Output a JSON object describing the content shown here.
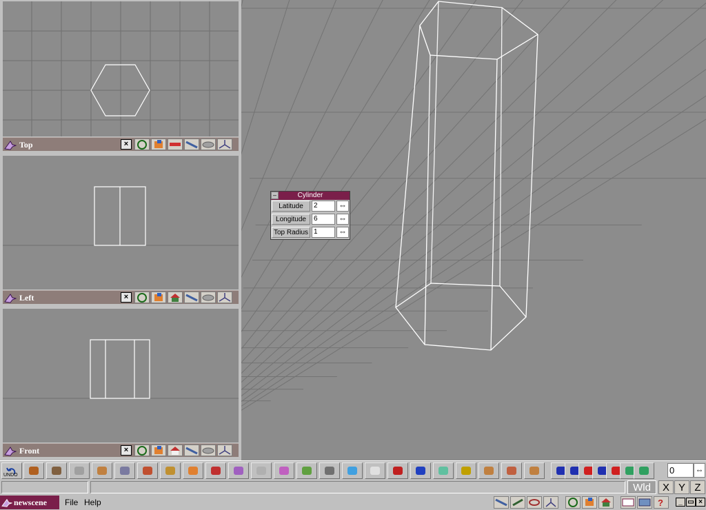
{
  "viewports": [
    {
      "title": "Top",
      "close": "×"
    },
    {
      "title": "Left",
      "close": "×"
    },
    {
      "title": "Front",
      "close": "×"
    }
  ],
  "cylinder_panel": {
    "title": "Cylinder",
    "collapse": "–",
    "rows": [
      {
        "label": "Latitude",
        "value": "2"
      },
      {
        "label": "Longitude",
        "value": "6"
      },
      {
        "label": "Top Radius",
        "value": "1"
      }
    ],
    "spinner_glyph": "⇔"
  },
  "toolbar": {
    "undo_label": "UNDO",
    "frame_value": "0",
    "frame_spinner": "⇔",
    "icons": [
      "undo-icon",
      "cylinder-icon",
      "camera-icon",
      "select-arrow-icon",
      "move-icon",
      "sphere-grid-icon",
      "cube-icon",
      "cube-tan-icon",
      "sphere-icon",
      "split-sphere-icon",
      "cluster-icon",
      "torus-icon",
      "funnel-icon",
      "box-green-icon",
      "table-icon",
      "cube-blue-icon",
      "figure-icon",
      "axes-icon",
      "grid-icon",
      "plane-icon",
      "3d-icon",
      "deform-icon",
      "rotate-icon",
      "scale-icon",
      "rewind-icon",
      "step-back-icon",
      "play-icon",
      "fast-forward-icon",
      "record-icon",
      "keyframe-icon",
      "loop-icon"
    ]
  },
  "status": {
    "world_label": "Wld",
    "axes": [
      "X",
      "Y",
      "Z"
    ]
  },
  "menubar": {
    "scene_name": "newscene",
    "file_menu": "File",
    "help_menu": "Help",
    "min": "_",
    "restore": "▭",
    "close": "×"
  },
  "colors": {
    "title_bar": "#7a1f4a",
    "viewport_bar": "#8e7d79",
    "background": "#8c8c8c"
  }
}
